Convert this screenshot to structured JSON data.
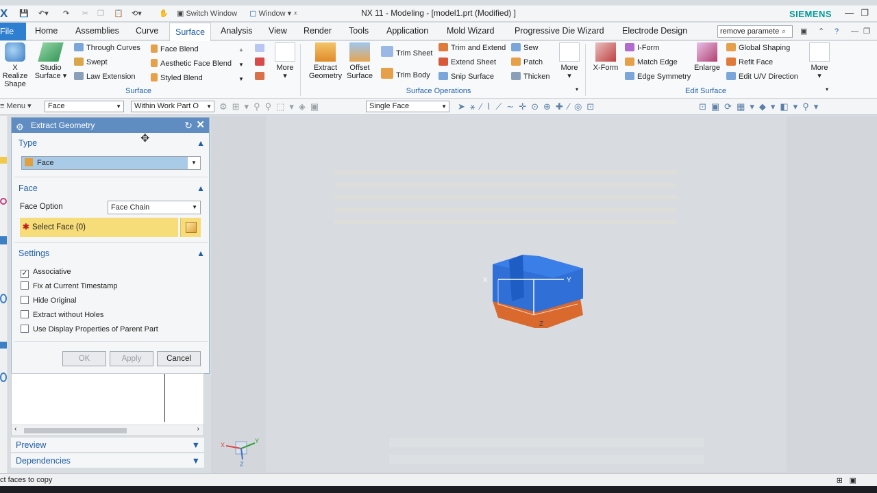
{
  "titlebar": {
    "app_icon": "X",
    "switch_window": "Switch Window",
    "window": "Window",
    "title": "NX 11 - Modeling - [model1.prt (Modified) ]",
    "brand": "SIEMENS",
    "brand_color": "#009999"
  },
  "tabs": [
    "File",
    "Home",
    "Assemblies",
    "Curve",
    "Surface",
    "Analysis",
    "View",
    "Render",
    "Tools",
    "Application",
    "Mold Wizard",
    "Progressive Die Wizard",
    "Electrode Design"
  ],
  "active_tab": "Surface",
  "search": {
    "value": "remove paramete"
  },
  "ribbon": {
    "surface_group": {
      "label": "Surface",
      "x_realize": "X Realize\nShape",
      "studio_surface": "Studio\nSurface",
      "through_curves": "Through Curves",
      "swept": "Swept",
      "law_extension": "Law Extension",
      "face_blend": "Face Blend",
      "aesthetic_face_blend": "Aesthetic Face Blend",
      "styled_blend": "Styled Blend",
      "more": "More"
    },
    "surface_operations": {
      "label": "Surface Operations",
      "extract_geometry": "Extract\nGeometry",
      "offset_surface": "Offset\nSurface",
      "trim_sheet": "Trim Sheet",
      "trim_body": "Trim Body",
      "trim_and_extend": "Trim and Extend",
      "extend_sheet": "Extend Sheet",
      "snip_surface": "Snip Surface",
      "sew": "Sew",
      "patch": "Patch",
      "thicken": "Thicken",
      "more": "More"
    },
    "edit_surface": {
      "label": "Edit Surface",
      "x_form": "X-Form",
      "i_form": "I-Form",
      "match_edge": "Match Edge",
      "edge_symmetry": "Edge Symmetry",
      "enlarge": "Enlarge",
      "global_shaping": "Global Shaping",
      "refit_face": "Refit Face",
      "edit_uv_direction": "Edit U/V Direction",
      "more": "More"
    }
  },
  "toolbar": {
    "menu": "Menu",
    "filter": "Face",
    "scope": "Within Work Part O",
    "face_rule": "Single Face"
  },
  "dialog": {
    "title": "Extract Geometry",
    "type_section": "Type",
    "type_value": "Face",
    "face_section": "Face",
    "face_option_label": "Face Option",
    "face_option_value": "Face Chain",
    "select_face": "Select Face (0)",
    "settings_section": "Settings",
    "settings": [
      {
        "label": "Associative",
        "checked": true
      },
      {
        "label": "Fix at Current Timestamp",
        "checked": false
      },
      {
        "label": "Hide Original",
        "checked": false
      },
      {
        "label": "Extract without Holes",
        "checked": false
      },
      {
        "label": "Use Display Properties of Parent Part",
        "checked": false
      }
    ],
    "ok": "OK",
    "apply": "Apply",
    "cancel": "Cancel",
    "highlight_color": "#f7dc7a"
  },
  "navigator": {
    "preview": "Preview",
    "dependencies": "Dependencies"
  },
  "viewport": {
    "axis_y": "Y",
    "axis_x": "X",
    "axis_z": "Z",
    "solid_top_color": "#2f6fd6",
    "solid_bottom_color": "#d9692c"
  },
  "status": {
    "prompt": "ct faces to copy"
  }
}
